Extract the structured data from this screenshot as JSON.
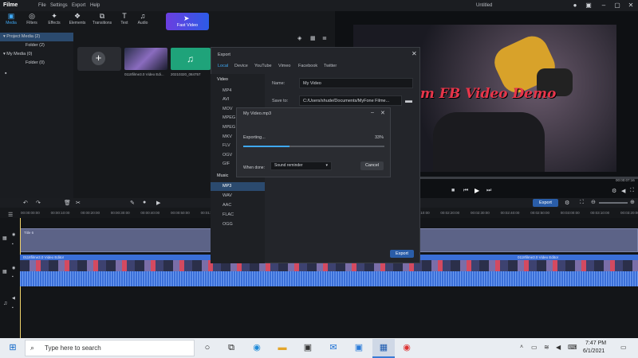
{
  "app": {
    "logo": "Filme",
    "menu": [
      "File",
      "Settings",
      "Export",
      "Help"
    ],
    "window_title": "Untitled"
  },
  "toolbar": {
    "items": [
      {
        "label": "Media",
        "icon": "folder-icon"
      },
      {
        "label": "Filters",
        "icon": "filters-icon"
      },
      {
        "label": "Effects",
        "icon": "effects-icon"
      },
      {
        "label": "Elements",
        "icon": "elements-icon"
      },
      {
        "label": "Transitions",
        "icon": "transitions-icon"
      },
      {
        "label": "Text",
        "icon": "text-icon"
      },
      {
        "label": "Audio",
        "icon": "audio-icon"
      }
    ],
    "fast_video": "Fast Video"
  },
  "media_tree": [
    {
      "label": "▾ Project Media (2)",
      "selected": true
    },
    {
      "label": "Folder (2)"
    },
    {
      "label": "▾ My Media (0)"
    },
    {
      "label": "Folder (0)"
    }
  ],
  "media": {
    "items": [
      "0118filme3.0 Video Edi...",
      "20210320_084757"
    ]
  },
  "preview": {
    "overlay_text": "o from FB Video Demo",
    "time": "00:00:07:16"
  },
  "export_dialog": {
    "title": "Export",
    "tabs": [
      "Local",
      "Device",
      "YouTube",
      "Vimeo",
      "Facebook",
      "Twitter"
    ],
    "video_header": "Video",
    "video_formats": [
      "MP4",
      "AVI",
      "MOV",
      "MPEG",
      "MPEG",
      "MKV",
      "FLV",
      "OGV",
      "GIF"
    ],
    "music_header": "Music",
    "music_formats": [
      "MP3",
      "WAV",
      "AAC",
      "FLAC",
      "OGG"
    ],
    "selected_format": "MP3",
    "name_label": "Name:",
    "name_value": "My Video",
    "save_label": "Save to:",
    "save_value": "C:/Users/shude/Documents/MyFone Filme...",
    "export_button": "Export"
  },
  "progress_dialog": {
    "title": "My Video.mp3",
    "status": "Exporting...",
    "percent_text": "33%",
    "progress": 0.33,
    "when_done_label": "When done:",
    "when_done_value": "Sound reminder",
    "cancel": "Cancel"
  },
  "timeline": {
    "export_button": "Export",
    "ruler": [
      "00:00:00:00",
      "00:00:10:00",
      "00:00:20:00",
      "00:00:30:00",
      "00:00:40:00",
      "00:00:50:00",
      "00:01:00:00",
      "00:01:10:00",
      "00:01:20:00",
      "00:01:30:00",
      "00:01:40:00",
      "00:01:50:00",
      "00:02:00:00",
      "00:02:10:00",
      "00:02:20:00",
      "00:02:30:00",
      "00:02:40:00",
      "00:02:50:00",
      "00:03:00:00",
      "00:03:10:00",
      "00:03:20:00"
    ],
    "text_clip": "Title 6",
    "video_clip": "0118filme3.0 Video Editor",
    "video_clip2": "0118filme3.0 Video Editor"
  },
  "taskbar": {
    "search_placeholder": "Type here to search",
    "time": "7:47 PM",
    "date": "6/1/2021"
  },
  "colors": {
    "accent": "#3fa9f5",
    "selection": "#2b4a6e",
    "title_red": "#e8354a",
    "track_blue": "#3a6fd8"
  }
}
